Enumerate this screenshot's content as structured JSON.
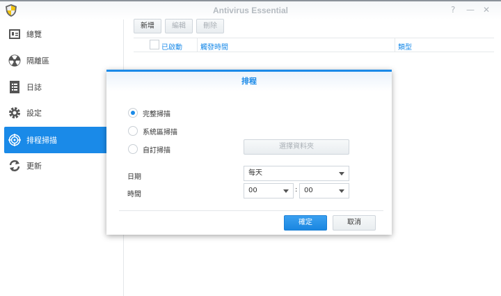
{
  "window": {
    "title": "Antivirus Essential",
    "help": "?",
    "minimize": "—",
    "close": "✕"
  },
  "sidebar": {
    "items": [
      {
        "label": "總覽",
        "icon": "overview-card-icon"
      },
      {
        "label": "隔離區",
        "icon": "quarantine-radiation-icon"
      },
      {
        "label": "日誌",
        "icon": "log-document-icon"
      },
      {
        "label": "設定",
        "icon": "gear-icon"
      },
      {
        "label": "排程掃描",
        "icon": "target-icon",
        "active": true
      },
      {
        "label": "更新",
        "icon": "refresh-icon"
      }
    ]
  },
  "toolbar": {
    "add": "新增",
    "edit": "編輯",
    "delete": "刪除"
  },
  "table": {
    "columns": [
      "已啟動",
      "觸發時間",
      "類型"
    ]
  },
  "dialog": {
    "title": "排程",
    "options": [
      "完整掃描",
      "系統區掃描",
      "自訂掃描"
    ],
    "selected_option": "完整掃描",
    "choose_folder": "選擇資料夾",
    "date_label": "日期",
    "date_value": "每天",
    "time_label": "時間",
    "hour": "00",
    "minute": "00",
    "separator": ":",
    "ok": "確定",
    "cancel": "取消"
  },
  "colors": {
    "accent": "#1a8ae8"
  }
}
